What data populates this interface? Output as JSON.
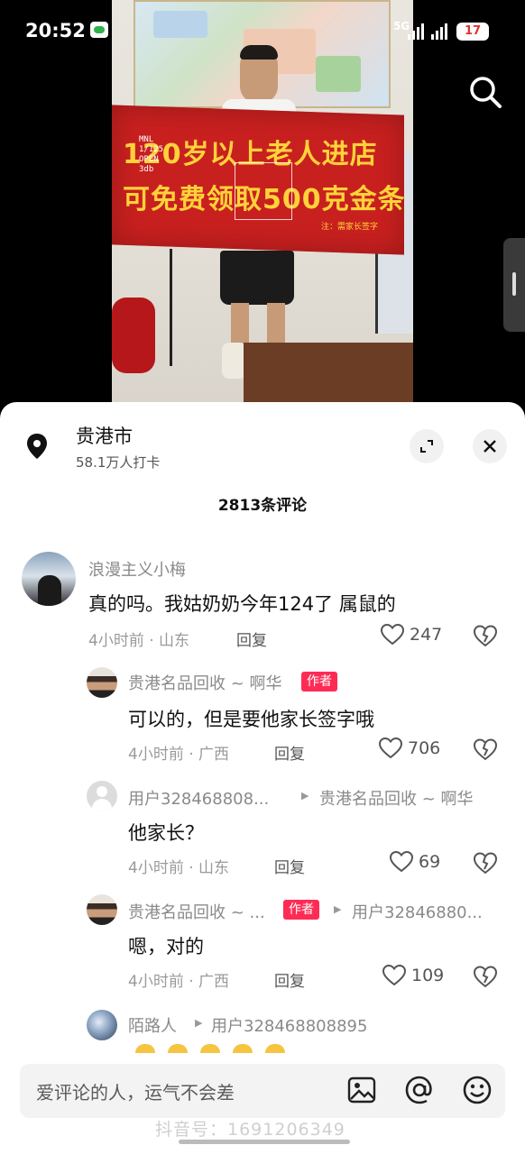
{
  "status_bar": {
    "time": "20:52",
    "network": "5G",
    "battery": "17"
  },
  "video": {
    "banner_line1": "120岁以上老人进店",
    "banner_line2": "可免费领取500克金条",
    "banner_note": "注：需家长签字",
    "logo_tag": "MNL\n1/125\nOPEN\n3db"
  },
  "location": {
    "name": "贵港市",
    "checkins": "58.1万人打卡"
  },
  "comment_count": "2813条评论",
  "comments": [
    {
      "user": "浪漫主义小梅",
      "text": "真的吗。我姑奶奶今年124了 属鼠的",
      "time_place": "4小时前 · 山东",
      "reply": "回复",
      "likes": "247"
    },
    {
      "user": "贵港名品回收 ~ 啊华",
      "badge": "作者",
      "text": "可以的，但是要他家长签字哦",
      "time_place": "4小时前 · 广西",
      "reply": "回复",
      "likes": "706"
    },
    {
      "user": "用户328468808...",
      "reply_to": "贵港名品回收 ~ 啊华",
      "text": "他家长？",
      "time_place": "4小时前 · 山东",
      "reply": "回复",
      "likes": "69"
    },
    {
      "user": "贵港名品回收 ~ ...",
      "badge": "作者",
      "reply_to": "用户32846880...",
      "text": "嗯，对的",
      "time_place": "4小时前 · 广西",
      "reply": "回复",
      "likes": "109"
    },
    {
      "user": "陌路人",
      "reply_to": "用户328468808895"
    }
  ],
  "input": {
    "placeholder": "爱评论的人，运气不会差"
  },
  "watermark": "抖音号：1691206349",
  "colors": {
    "accent": "#fe2c55",
    "banner": "#c8201f",
    "banner_text": "#ffd23a"
  }
}
